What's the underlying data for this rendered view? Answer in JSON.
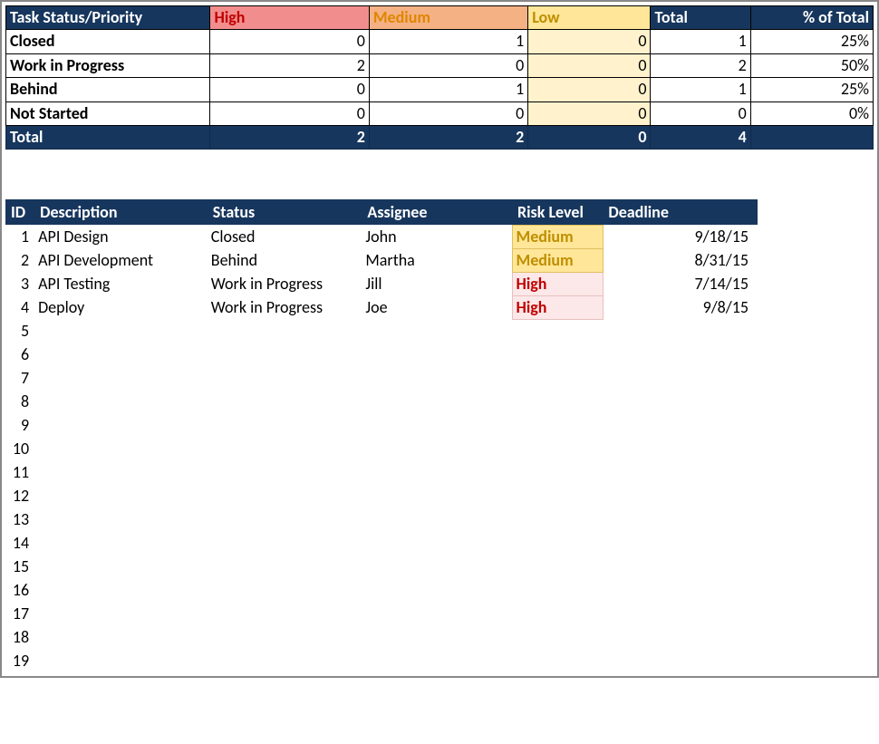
{
  "summary": {
    "headers": {
      "task_status_priority": "Task Status/Priority",
      "high": "High",
      "medium": "Medium",
      "low": "Low",
      "total": "Total",
      "pct_of_total": "% of Total"
    },
    "rows": [
      {
        "status": "Closed",
        "high": "0",
        "medium": "1",
        "low": "0",
        "total": "1",
        "pct": "25%"
      },
      {
        "status": "Work in Progress",
        "high": "2",
        "medium": "0",
        "low": "0",
        "total": "2",
        "pct": "50%"
      },
      {
        "status": "Behind",
        "high": "0",
        "medium": "1",
        "low": "0",
        "total": "1",
        "pct": "25%"
      },
      {
        "status": "Not Started",
        "high": "0",
        "medium": "0",
        "low": "0",
        "total": "0",
        "pct": "0%"
      }
    ],
    "total_row": {
      "status": "Total",
      "high": "2",
      "medium": "2",
      "low": "0",
      "total": "4",
      "pct": ""
    }
  },
  "tasks": {
    "headers": {
      "id": "ID",
      "description": "Description",
      "status": "Status",
      "assignee": "Assignee",
      "risk_level": "Risk Level",
      "deadline": "Deadline"
    },
    "rows": [
      {
        "id": "1",
        "description": "API Design",
        "status": "Closed",
        "assignee": "John",
        "risk": "Medium",
        "risk_class": "medium",
        "deadline": "9/18/15"
      },
      {
        "id": "2",
        "description": "API Development",
        "status": "Behind",
        "assignee": "Martha",
        "risk": "Medium",
        "risk_class": "medium",
        "deadline": "8/31/15"
      },
      {
        "id": "3",
        "description": "API Testing",
        "status": "Work in Progress",
        "assignee": "Jill",
        "risk": "High",
        "risk_class": "high",
        "deadline": "7/14/15"
      },
      {
        "id": "4",
        "description": "Deploy",
        "status": "Work in Progress",
        "assignee": "Joe",
        "risk": "High",
        "risk_class": "high",
        "deadline": "9/8/15"
      }
    ],
    "empty_ids": [
      "5",
      "6",
      "7",
      "8",
      "9",
      "10",
      "11",
      "12",
      "13",
      "14",
      "15",
      "16",
      "17",
      "18",
      "19"
    ]
  }
}
